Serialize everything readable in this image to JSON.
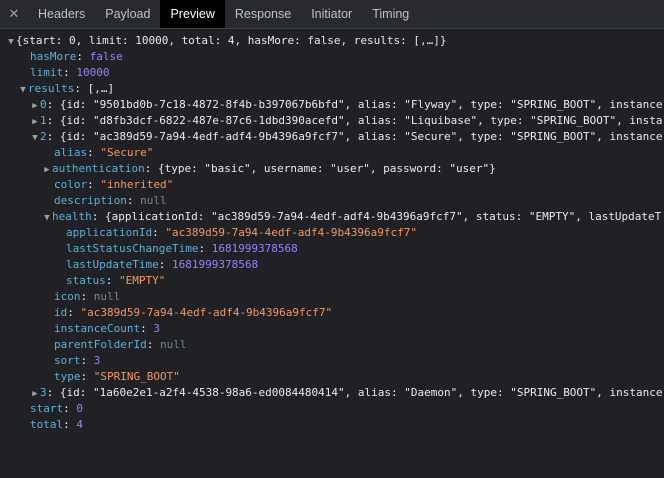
{
  "tabs": [
    {
      "label": "Headers"
    },
    {
      "label": "Payload"
    },
    {
      "label": "Preview"
    },
    {
      "label": "Response"
    },
    {
      "label": "Initiator"
    },
    {
      "label": "Timing"
    }
  ],
  "active_tab": "Preview",
  "colors": {
    "key": "#5db0d7",
    "string": "#f29766",
    "number": "#9980ff",
    "null": "#7f8487"
  },
  "preview": {
    "root_summary": "{start: 0, limit: 10000, total: 4, hasMore: false, results: [,…]}",
    "hasMore": "false",
    "limit": "10000",
    "results_summary": "[,…]",
    "results": {
      "item0_summary": "{id: \"9501bd0b-7c18-4872-8f4b-b397067b6bfd\", alias: \"Flyway\", type: \"SPRING_BOOT\", instance",
      "item1_summary": "{id: \"d8fb3dcf-6822-487e-87c6-1dbd390acefd\", alias: \"Liquibase\", type: \"SPRING_BOOT\", insta",
      "item2_summary": "{id: \"ac389d59-7a94-4edf-adf4-9b4396a9fcf7\", alias: \"Secure\", type: \"SPRING_BOOT\", instance",
      "item2": {
        "alias": "\"Secure\"",
        "authentication_summary": "{type: \"basic\", username: \"user\", password: \"user\"}",
        "color": "\"inherited\"",
        "description": "null",
        "health_summary": "{applicationId: \"ac389d59-7a94-4edf-adf4-9b4396a9fcf7\", status: \"EMPTY\", lastUpdateT",
        "health": {
          "applicationId": "\"ac389d59-7a94-4edf-adf4-9b4396a9fcf7\"",
          "lastStatusChangeTime": "1681999378568",
          "lastUpdateTime": "1681999378568",
          "status": "\"EMPTY\""
        },
        "icon": "null",
        "id": "\"ac389d59-7a94-4edf-adf4-9b4396a9fcf7\"",
        "instanceCount": "3",
        "parentFolderId": "null",
        "sort": "3",
        "type": "\"SPRING_BOOT\""
      },
      "item3_summary": "{id: \"1a60e2e1-a2f4-4538-98a6-ed0084480414\", alias: \"Daemon\", type: \"SPRING_BOOT\", instance"
    },
    "start": "0",
    "total": "4"
  }
}
